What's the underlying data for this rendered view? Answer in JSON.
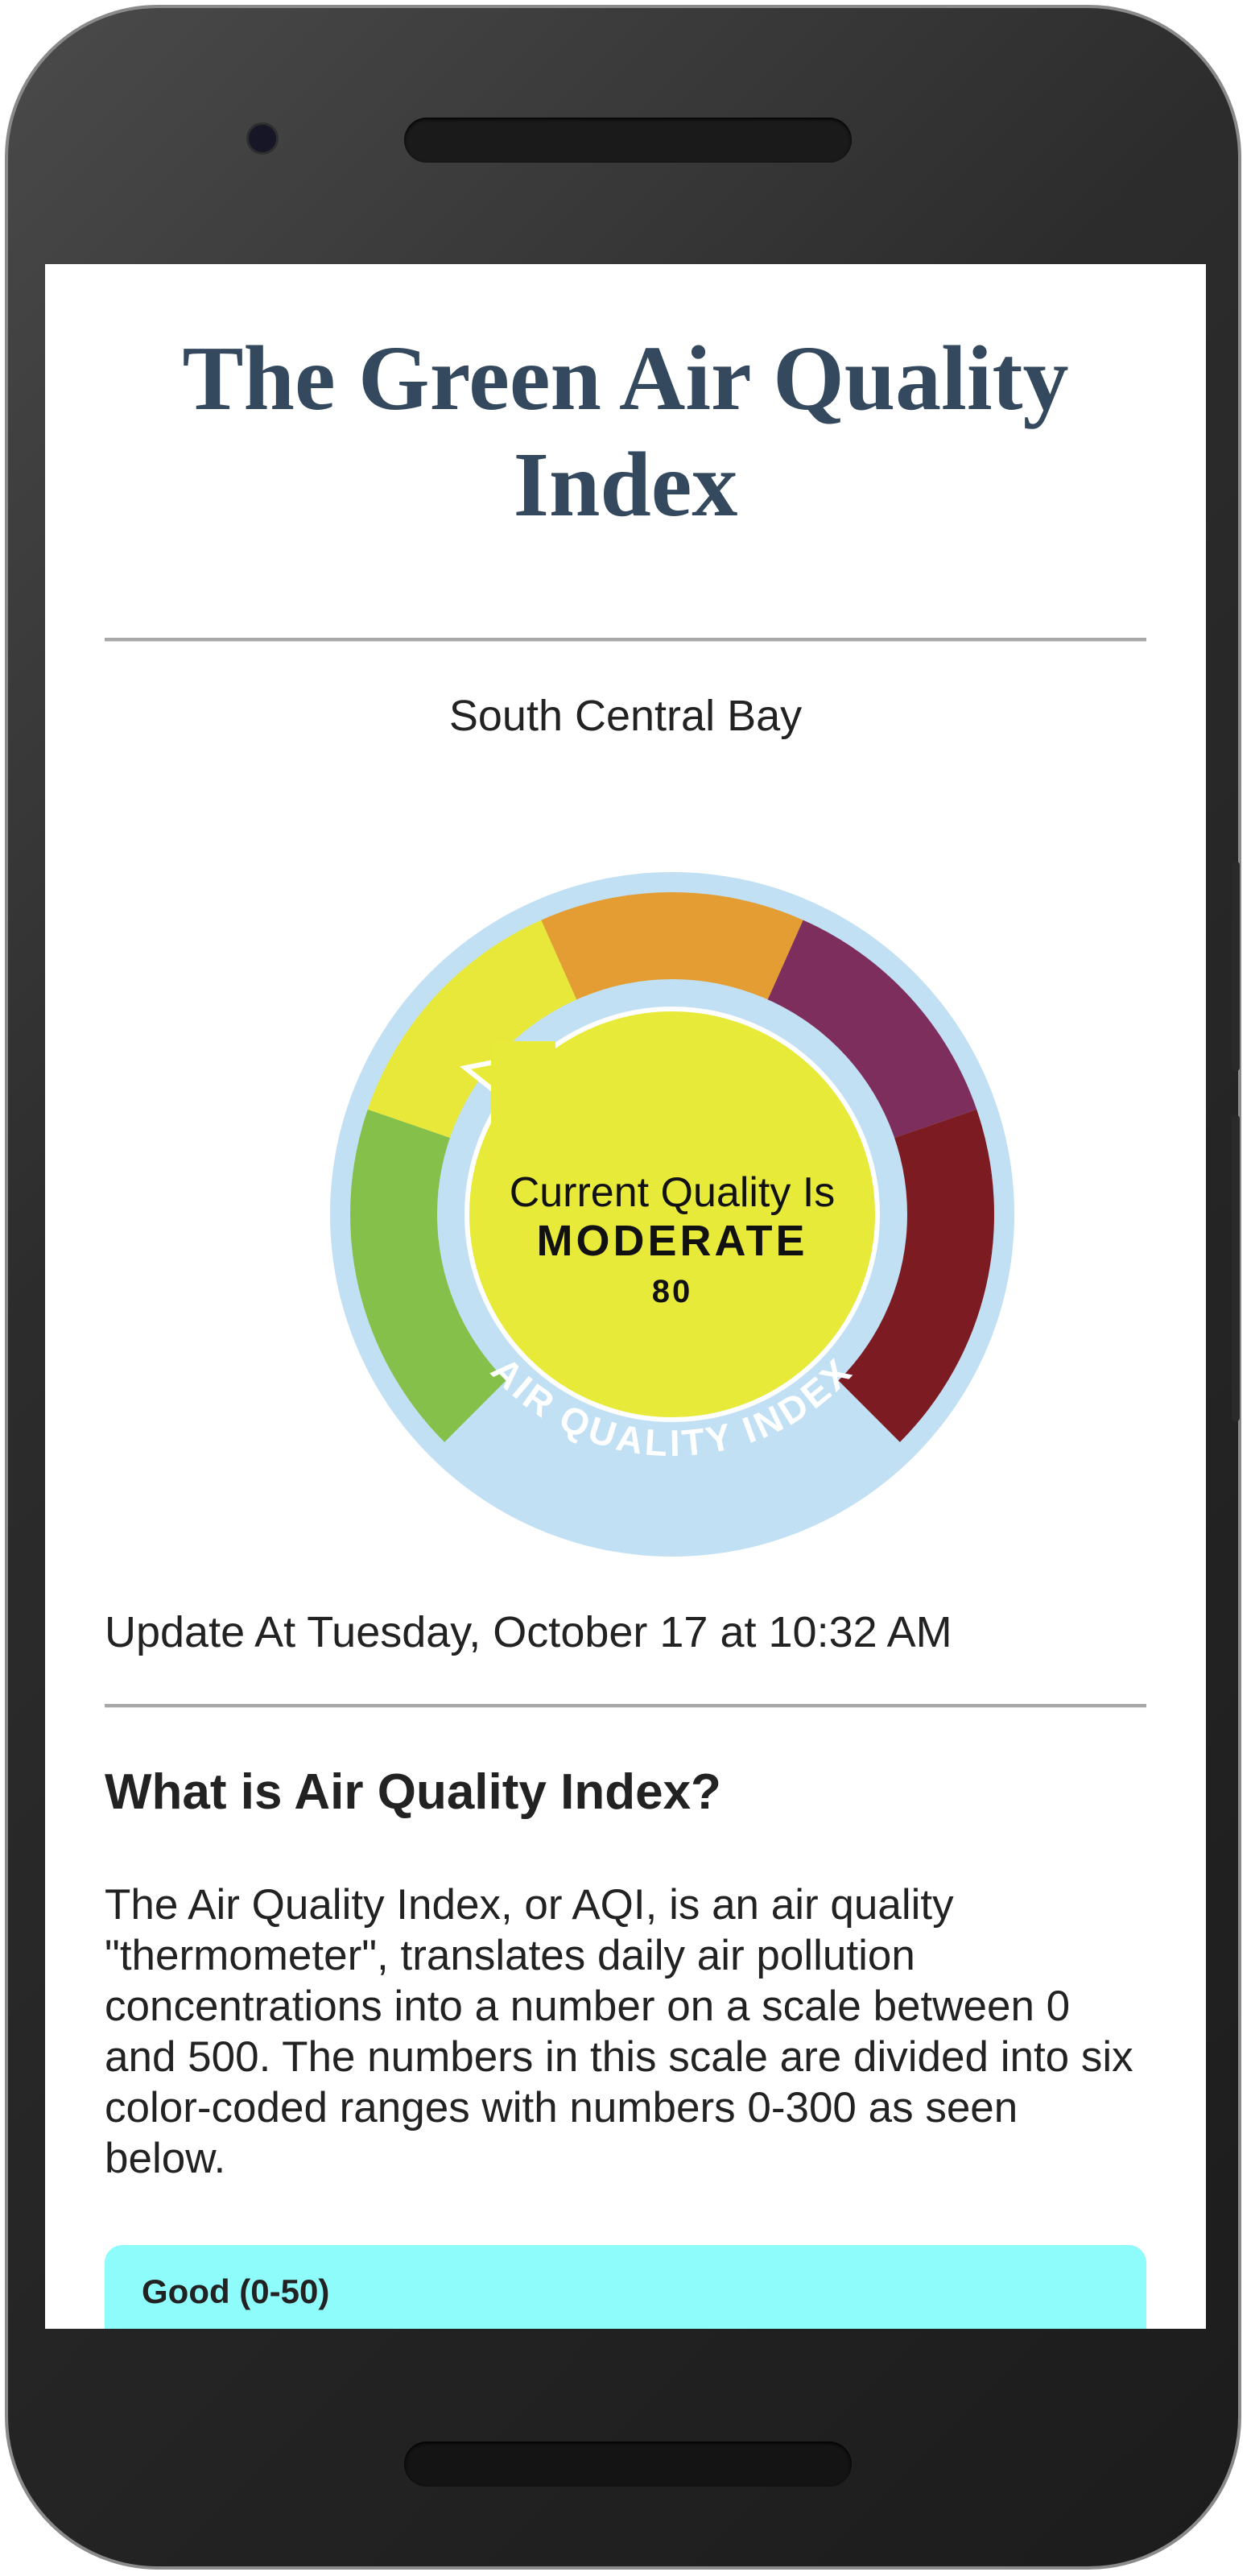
{
  "page": {
    "title": "The Green Air Quality Index",
    "location": "South Central Bay",
    "updated": "Update At Tuesday, October 17 at 10:32 AM"
  },
  "gauge": {
    "prefix": "Current Quality Is",
    "level": "MODERATE",
    "value": "80",
    "ring_label": "AIR QUALITY INDEX",
    "colors": {
      "ring": "#c2e0f4",
      "good": "#85c04a",
      "moderate": "#e8e83a",
      "unhealthy_sensitive": "#e49d33",
      "unhealthy": "#7e2e5c",
      "very_unhealthy": "#7c1c22",
      "center": "#e8ea3a"
    }
  },
  "info": {
    "heading": "What is Air Quality Index?",
    "body": "The Air Quality Index, or AQI, is an air quality \"thermometer\", translates daily air pollution concentrations into a number on a scale between 0 and 500. The numbers in this scale are divided into six color-coded ranges with numbers 0-300 as seen below."
  },
  "ranges": [
    {
      "label": "Good (0-50)",
      "color": "#8ffcfc"
    }
  ]
}
